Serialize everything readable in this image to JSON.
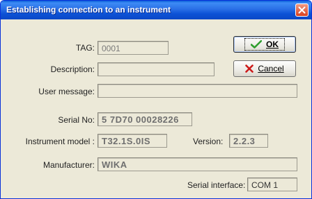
{
  "window": {
    "title": "Establishing connection to an instrument"
  },
  "icons": {
    "close": "close-icon",
    "ok": "checkmark-icon",
    "cancel": "red-x-icon"
  },
  "buttons": {
    "ok_label": "OK",
    "cancel_label": "Cancel"
  },
  "fields": {
    "tag": {
      "label": "TAG:",
      "value": "0001"
    },
    "description": {
      "label": "Description:",
      "value": ""
    },
    "user_message": {
      "label": "User message:",
      "value": ""
    },
    "serial_no": {
      "label": "Serial No:",
      "value": "5 7D70 00028226"
    },
    "instrument_model": {
      "label": "Instrument model :",
      "value": "T32.1S.0IS"
    },
    "version": {
      "label": "Version:",
      "value": "2.2.3"
    },
    "manufacturer": {
      "label": "Manufacturer:",
      "value": "WIKA"
    },
    "serial_interface": {
      "label": "Serial interface:",
      "value": "COM 1"
    }
  },
  "colors": {
    "titlebar": "#0a48c6",
    "dialog_bg": "#ece9d8",
    "close_red": "#d8401f",
    "ok_check": "#2f9e2f",
    "cancel_x": "#cc1a1a"
  }
}
